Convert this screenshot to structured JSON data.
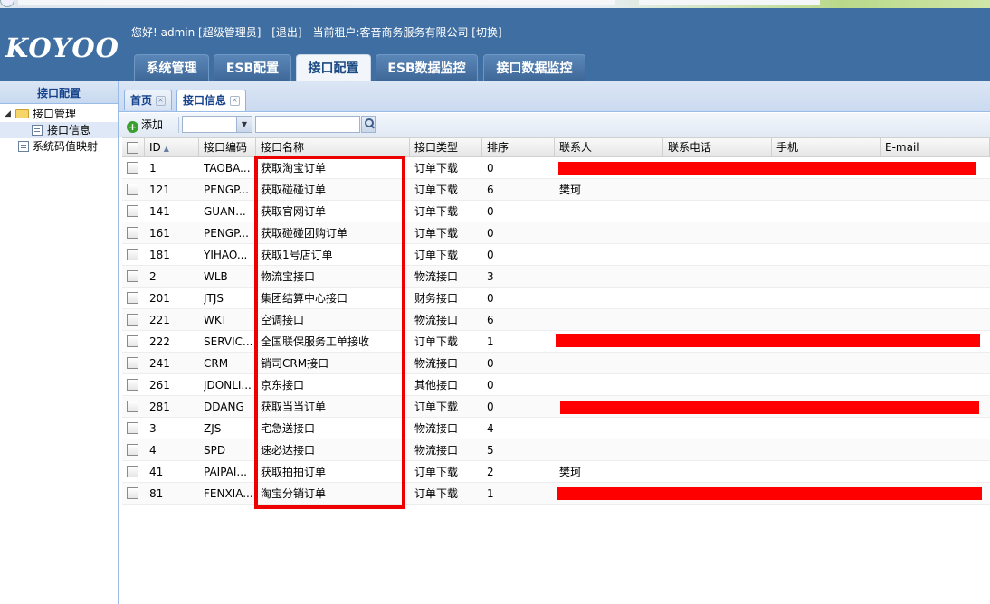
{
  "app": {
    "logo": "KOYOO",
    "greeting": "您好! admin [超级管理员]",
    "logout": "[退出]",
    "tenant": "当前租户:客音商务服务有限公司 [切换]"
  },
  "nav_tabs": [
    {
      "label": "系统管理",
      "active": false
    },
    {
      "label": "ESB配置",
      "active": false
    },
    {
      "label": "接口配置",
      "active": true
    },
    {
      "label": "ESB数据监控",
      "active": false
    },
    {
      "label": "接口数据监控",
      "active": false
    }
  ],
  "sidebar": {
    "title": "接口配置",
    "items": [
      {
        "label": "接口管理",
        "level": 0,
        "icon": "folder-icon"
      },
      {
        "label": "接口信息",
        "level": 1,
        "icon": "page-icon",
        "selected": true
      },
      {
        "label": "系统码值映射",
        "level": 0,
        "icon": "page-icon"
      }
    ]
  },
  "content_tabs": [
    {
      "label": "首页",
      "active": false
    },
    {
      "label": "接口信息",
      "active": true
    }
  ],
  "toolbar": {
    "add_label": "添加",
    "filter_value": "",
    "search_value": ""
  },
  "grid": {
    "columns": [
      "ID",
      "接口编码",
      "接口名称",
      "接口类型",
      "排序",
      "联系人",
      "联系电话",
      "手机",
      "E-mail"
    ],
    "rows": [
      {
        "id": "1",
        "code": "TAOBA...",
        "name": "获取淘宝订单",
        "type": "订单下载",
        "sort": "0",
        "contact": ""
      },
      {
        "id": "121",
        "code": "PENGP...",
        "name": "获取碰碰订单",
        "type": "订单下载",
        "sort": "6",
        "contact": "樊珂"
      },
      {
        "id": "141",
        "code": "GUAN...",
        "name": "获取官网订单",
        "type": "订单下载",
        "sort": "0",
        "contact": ""
      },
      {
        "id": "161",
        "code": "PENGP...",
        "name": "获取碰碰团购订单",
        "type": "订单下载",
        "sort": "0",
        "contact": ""
      },
      {
        "id": "181",
        "code": "YIHAO...",
        "name": "获取1号店订单",
        "type": "订单下载",
        "sort": "0",
        "contact": ""
      },
      {
        "id": "2",
        "code": "WLB",
        "name": "物流宝接口",
        "type": "物流接口",
        "sort": "3",
        "contact": ""
      },
      {
        "id": "201",
        "code": "JTJS",
        "name": "集团结算中心接口",
        "type": "财务接口",
        "sort": "0",
        "contact": ""
      },
      {
        "id": "221",
        "code": "WKT",
        "name": "空调接口",
        "type": "物流接口",
        "sort": "6",
        "contact": ""
      },
      {
        "id": "222",
        "code": "SERVIC...",
        "name": "全国联保服务工单接收",
        "type": "订单下载",
        "sort": "1",
        "contact": ""
      },
      {
        "id": "241",
        "code": "CRM",
        "name": "销司CRM接口",
        "type": "物流接口",
        "sort": "0",
        "contact": ""
      },
      {
        "id": "261",
        "code": "JDONLI...",
        "name": "京东接口",
        "type": "其他接口",
        "sort": "0",
        "contact": ""
      },
      {
        "id": "281",
        "code": "DDANG",
        "name": "获取当当订单",
        "type": "订单下载",
        "sort": "0",
        "contact": ""
      },
      {
        "id": "3",
        "code": "ZJS",
        "name": "宅急送接口",
        "type": "物流接口",
        "sort": "4",
        "contact": ""
      },
      {
        "id": "4",
        "code": "SPD",
        "name": "速必达接口",
        "type": "物流接口",
        "sort": "5",
        "contact": ""
      },
      {
        "id": "41",
        "code": "PAIPAI...",
        "name": "获取拍拍订单",
        "type": "订单下载",
        "sort": "2",
        "contact": "樊珂"
      },
      {
        "id": "81",
        "code": "FENXIA...",
        "name": "淘宝分销订单",
        "type": "订单下载",
        "sort": "1",
        "contact": ""
      }
    ]
  },
  "colors": {
    "header_bg": "#3e6ea2",
    "redaction": "#ff0000",
    "highlight_border": "#ee0000"
  }
}
